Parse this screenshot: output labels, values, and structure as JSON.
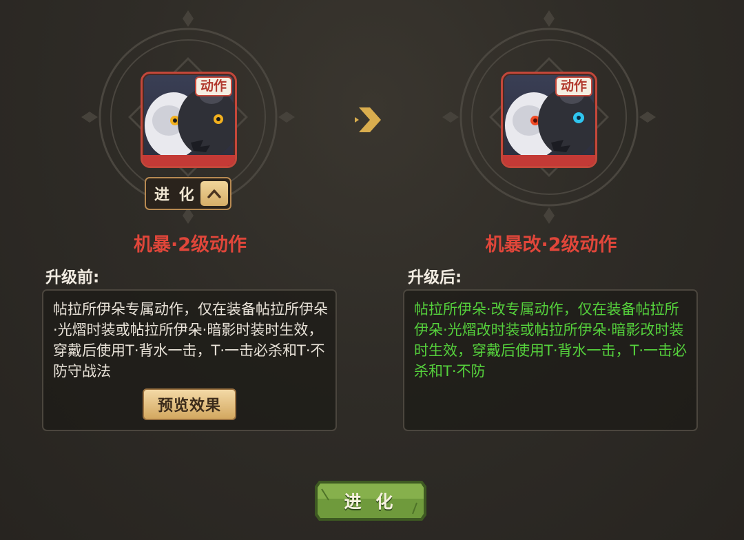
{
  "before": {
    "card_tag": "动作",
    "evolve_tab_label": "进 化",
    "skill_name": "机暴·2级动作",
    "section_label": "升级前:",
    "description": "帖拉所伊朵专属动作，仅在装备帖拉所伊朵·光熠时装或帖拉所伊朵·暗影时装时生效，穿戴后使用T·背水一击，T·一击必杀和T·不防守战法",
    "preview_button": "预览效果"
  },
  "after": {
    "card_tag": "动作",
    "skill_name": "机暴改·2级动作",
    "section_label": "升级后:",
    "description": "帖拉所伊朵·改专属动作，仅在装备帖拉所伊朵·光熠改时装或帖拉所伊朵·暗影改时装时生效，穿戴后使用T·背水一击，T·一击必杀和T·不防"
  },
  "evolve_button": "进 化",
  "colors": {
    "skill_name": "#e0463a",
    "after_text": "#55d13c",
    "card_border": "#c4473a",
    "button_green": "#6f9a3c"
  },
  "icons": {
    "transition": "chevron-right-icon",
    "tab_toggle": "chevron-up-icon"
  }
}
